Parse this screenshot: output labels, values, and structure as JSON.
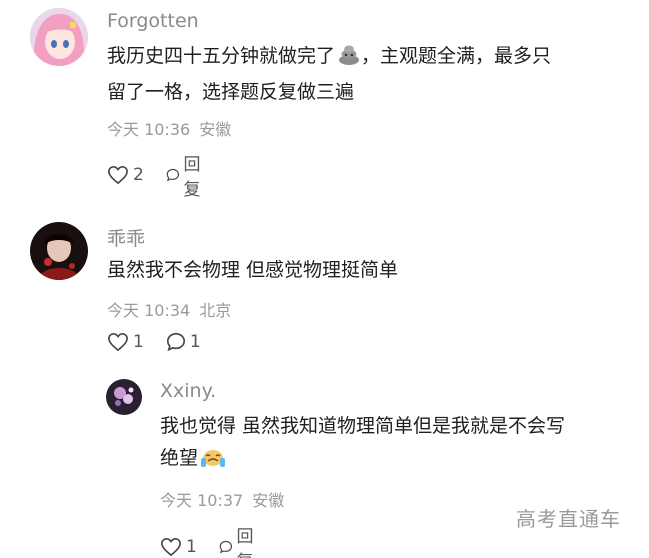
{
  "comments": [
    {
      "username": "Forgotten",
      "text_line1": "我历史四十五分钟就做完了",
      "text_line1_after": "，主观题全满，最多只",
      "text_line2": "留了一格，选择题反复做三遍",
      "time": "今天 10:36",
      "location": "安徽",
      "like_count": "2",
      "reply_label": "回复",
      "emoji_name": "poop-emoji"
    },
    {
      "username": "乖乖",
      "text_line1": "虽然我不会物理 但感觉物理挺简单",
      "time": "今天 10:34",
      "location": "北京",
      "like_count": "1",
      "reply_count": "1"
    }
  ],
  "reply": {
    "username": "Xxiny.",
    "text_line1": "我也觉得 虽然我知道物理简单但是我就是不会写",
    "text_line2": "绝望",
    "time": "今天 10:37",
    "location": "安徽",
    "like_count": "1",
    "reply_label": "回复",
    "emoji_name": "crying-emoji"
  },
  "watermark": "高考直通车",
  "colors": {
    "avatar1_hair": "#f4a6c6",
    "avatar2_bg": "#1a0f0f",
    "avatar3_bg": "#2a2030"
  }
}
